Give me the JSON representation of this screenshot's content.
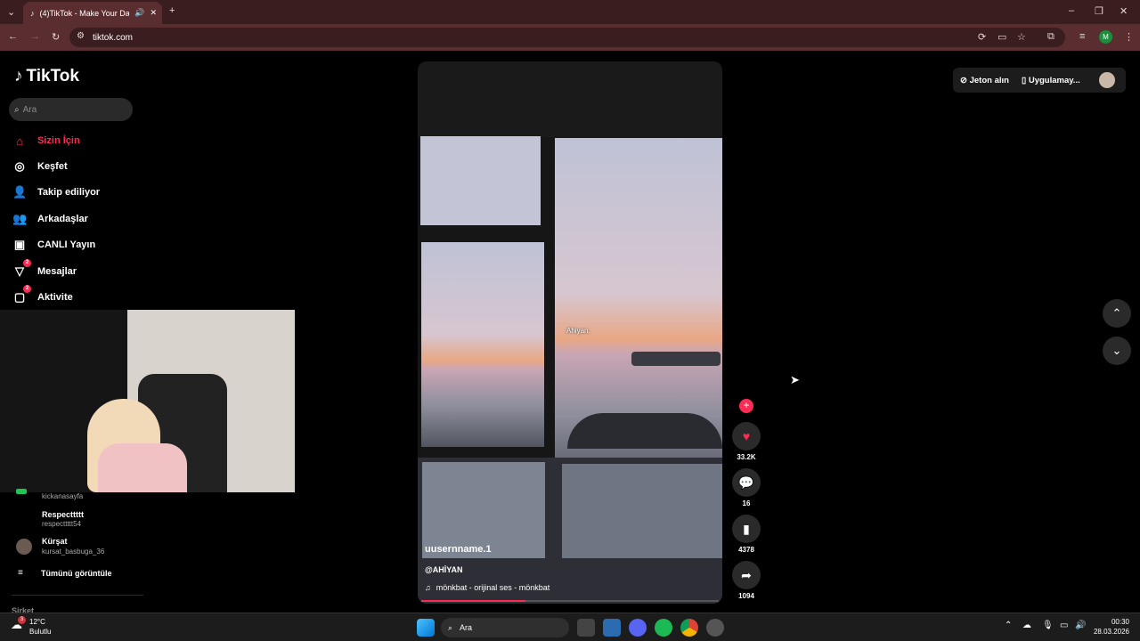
{
  "browser": {
    "tab_title": "(4)TikTok - Make Your Day",
    "url": "tiktok.com"
  },
  "sidebar": {
    "logo": "TikTok",
    "search_placeholder": "Ara",
    "items": [
      {
        "label": "Sizin İçin",
        "icon": "home-icon",
        "active": true,
        "badge": ""
      },
      {
        "label": "Keşfet",
        "icon": "compass-icon",
        "active": false,
        "badge": ""
      },
      {
        "label": "Takip ediliyor",
        "icon": "following-icon",
        "active": false,
        "badge": ""
      },
      {
        "label": "Arkadaşlar",
        "icon": "friends-icon",
        "active": false,
        "badge": ""
      },
      {
        "label": "CANLI Yayın",
        "icon": "live-icon",
        "active": false,
        "badge": ""
      },
      {
        "label": "Mesajlar",
        "icon": "messages-icon",
        "active": false,
        "badge": "2"
      },
      {
        "label": "Aktivite",
        "icon": "activity-icon",
        "active": false,
        "badge": "2"
      }
    ],
    "accounts": [
      {
        "name": "",
        "handle": "kickanasayfa"
      },
      {
        "name": "Respecttttt",
        "handle": "respecttttt54"
      },
      {
        "name": "Kürşat",
        "handle": "kursat_basbuga_36"
      }
    ],
    "see_all": "Tümünü görüntüle",
    "footer": "Şirket"
  },
  "video": {
    "overlay_text": "Ahiyan.",
    "username": "uusernname.1",
    "caption": "@AHİYAN",
    "sound": "mönkbat - orijinal ses - mönkbat",
    "progress": 0.35
  },
  "actions": {
    "likes": "33.2K",
    "comments": "16",
    "saves": "4378",
    "shares": "1094"
  },
  "top_right": {
    "coins": "Jeton alın",
    "app": "Uygulamay..."
  },
  "taskbar": {
    "weather_temp": "12°C",
    "weather_desc": "Bulutlu",
    "weather_badge": "3",
    "search": "Ara",
    "time": "00:30",
    "date": "28.03.2026"
  }
}
